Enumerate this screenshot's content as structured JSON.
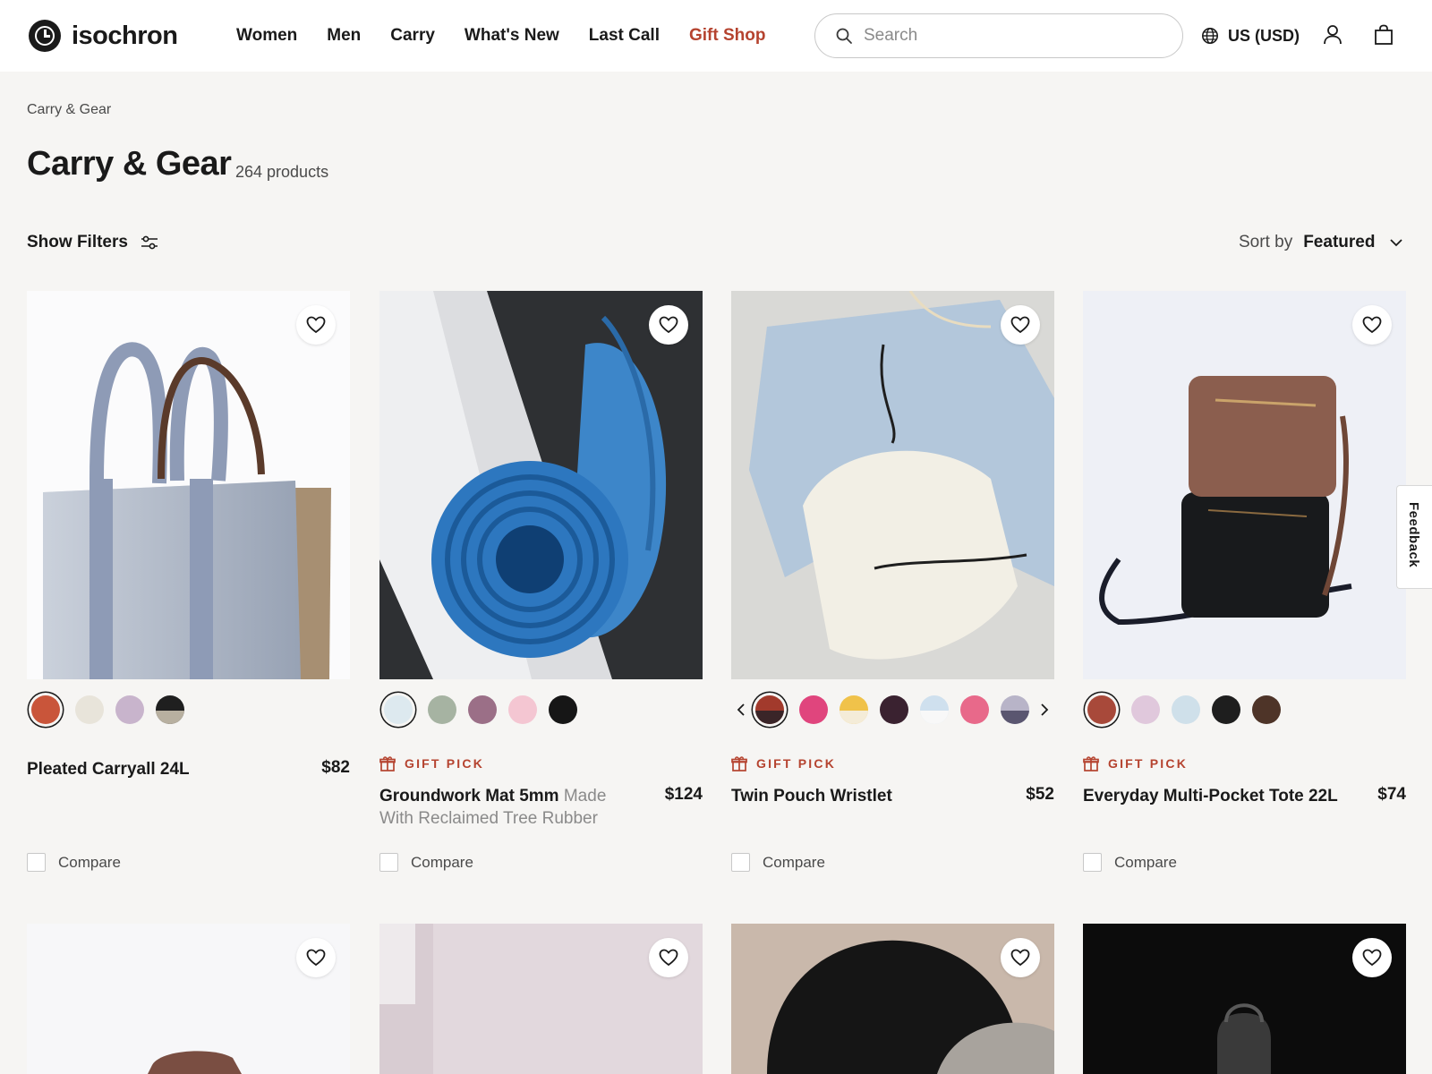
{
  "brand": {
    "name": "isochron"
  },
  "nav": {
    "items": [
      "Women",
      "Men",
      "Carry",
      "What's New",
      "Last Call"
    ],
    "gift_shop": "Gift Shop"
  },
  "search": {
    "placeholder": "Search"
  },
  "locale": {
    "label": "US (USD)"
  },
  "breadcrumb": "Carry & Gear",
  "page": {
    "title": "Carry & Gear",
    "count": "264 products"
  },
  "toolbar": {
    "filters_label": "Show Filters",
    "sort_label": "Sort by",
    "sort_value": "Featured"
  },
  "feedback_label": "Feedback",
  "gift_pick_label": "GIFT PICK",
  "compare_label": "Compare",
  "accent_color": "#b5432f",
  "products": [
    {
      "name": "Pleated Carryall 24L",
      "subtitle": "",
      "price": "$82",
      "gift_pick": false,
      "swatches": [
        "#c9553a",
        "#e8e4da",
        "#c8b4cc",
        "#1f1f1f/#b8b0a0"
      ],
      "selected_swatch": 0
    },
    {
      "name": "Groundwork Mat 5mm",
      "subtitle": "Made With Reclaimed Tree Rubber",
      "price": "$124",
      "gift_pick": true,
      "swatches": [
        "#dde9ef",
        "#a6b3a2",
        "#9b6f87",
        "#f4c6d2",
        "#161616"
      ],
      "selected_swatch": 0
    },
    {
      "name": "Twin Pouch Wristlet",
      "subtitle": "",
      "price": "$52",
      "gift_pick": true,
      "swatches": [
        "#a23a2c/#3a2528",
        "#e0457d",
        "#f0c24a/#f4ecd8",
        "#3a2230",
        "#cfe0ee/#f8f8f8",
        "#e8698a",
        "#b8b4c8/#5a5670"
      ],
      "selected_swatch": 0,
      "has_arrows": true
    },
    {
      "name": "Everyday Multi-Pocket Tote 22L",
      "subtitle": "",
      "price": "$74",
      "gift_pick": true,
      "swatches": [
        "#a8493a",
        "#e0c8dc",
        "#cfe0ea",
        "#1e1e1e",
        "#4e3428"
      ],
      "selected_swatch": 0
    }
  ]
}
